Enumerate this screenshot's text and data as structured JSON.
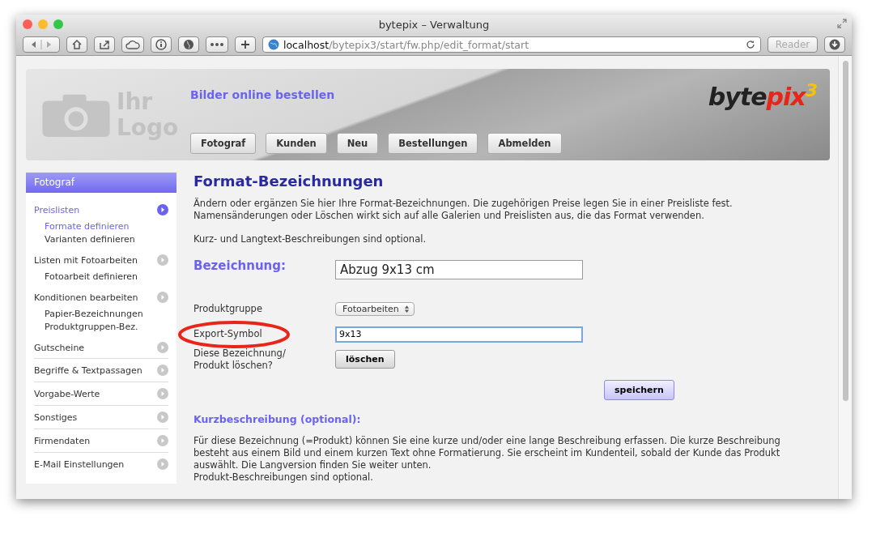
{
  "window": {
    "title": "bytepix – Verwaltung"
  },
  "toolbar": {
    "url_host": "localhost",
    "url_path": "/bytepix3/start/fw.php/edit_format/start",
    "reader": "Reader"
  },
  "header": {
    "logo_lines": [
      "Ihr",
      "Logo"
    ],
    "tagline": "Bilder online bestellen",
    "brand": {
      "text": "byte",
      "accent": "pix",
      "sup": "3"
    },
    "nav": [
      "Fotograf",
      "Kunden",
      "Neu",
      "Bestellungen",
      "Abmelden"
    ]
  },
  "sidebar": {
    "title": "Fotograf",
    "items": [
      {
        "label": "Preislisten",
        "selected": true,
        "children": [
          {
            "label": "Formate definieren",
            "selected": true
          },
          {
            "label": "Varianten definieren",
            "selected": false
          }
        ]
      },
      {
        "label": "Listen mit Fotoarbeiten",
        "selected": false,
        "children": [
          {
            "label": "Fotoarbeit definieren",
            "selected": false
          }
        ]
      },
      {
        "label": "Konditionen bearbeiten",
        "selected": false,
        "children": [
          {
            "label": "Papier-Bezeichnungen",
            "selected": false
          },
          {
            "label": "Produktgruppen-Bez.",
            "selected": false
          }
        ]
      },
      {
        "label": "Gutscheine",
        "selected": false
      },
      {
        "label": "Begriffe & Textpassagen",
        "selected": false
      },
      {
        "label": "Vorgabe-Werte",
        "selected": false
      },
      {
        "label": "Sonstiges",
        "selected": false
      },
      {
        "label": "Firmendaten",
        "selected": false
      },
      {
        "label": "E-Mail Einstellungen",
        "selected": false
      }
    ]
  },
  "main": {
    "title": "Format-Bezeichnungen",
    "intro": [
      "Ändern oder ergänzen Sie hier Ihre Format-Bezeichnungen. Die zugehörigen Preise legen Sie in einer Preisliste fest. Namensänderungen oder Löschen wirkt sich auf alle Galerien und Preislisten aus, die das Format verwenden.",
      "Kurz- und Langtext-Beschreibungen sind optional."
    ],
    "name_label": "Bezeichnung:",
    "name_value": "Abzug 9x13 cm",
    "rows": [
      {
        "kind": "select",
        "label": "Produktgruppe",
        "value": "Fotoarbeiten",
        "highlighted": false
      },
      {
        "kind": "input",
        "label": "Export-Symbol",
        "value": "9x13",
        "highlighted": true
      },
      {
        "kind": "button",
        "label": "Diese Bezeichnung/ Produkt löschen?",
        "value": "löschen",
        "highlighted": false
      }
    ],
    "save": "speichern",
    "section_title": "Kurzbeschreibung (optional):",
    "section_text": [
      "Für diese Bezeichnung (=Produkt) können Sie eine kurze und/oder eine lange Beschreibung erfassen. Die kurze Beschreibung besteht aus einem Bild und einem kurzen Text ohne Formatierung. Sie erscheint im Kundenteil, sobald der Kunde das Produkt auswählt. Die Langversion finden Sie weiter unten.",
      "Produkt-Beschreibungen sind optional."
    ]
  }
}
